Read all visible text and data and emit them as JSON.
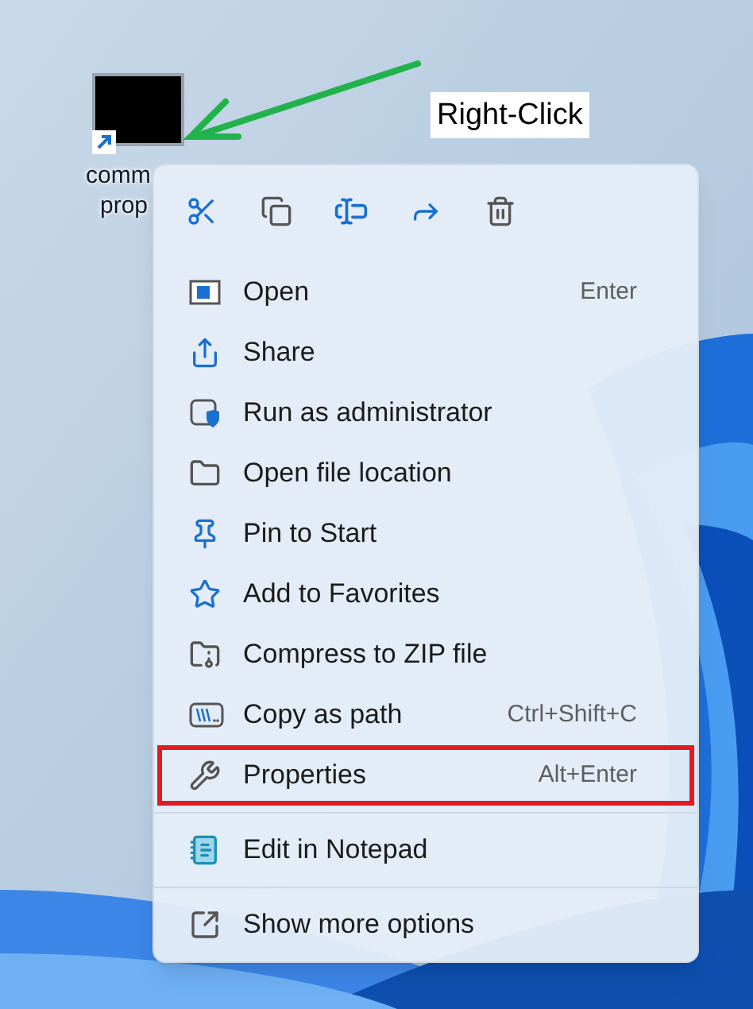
{
  "desktop_icon": {
    "label_lines": [
      "comm",
      "prop"
    ]
  },
  "annotation": {
    "label": "Right-Click"
  },
  "context_menu": {
    "groups": [
      [
        {
          "label": "Open",
          "shortcut": "Enter",
          "highlighted": false
        },
        {
          "label": "Share",
          "highlighted": false
        },
        {
          "label": "Run as administrator",
          "highlighted": false
        },
        {
          "label": "Open file location",
          "highlighted": false
        },
        {
          "label": "Pin to Start",
          "highlighted": false
        },
        {
          "label": "Add to Favorites",
          "highlighted": false
        },
        {
          "label": "Compress to ZIP file",
          "highlighted": false
        },
        {
          "label": "Copy as path",
          "shortcut": "Ctrl+Shift+C",
          "highlighted": false
        },
        {
          "label": "Properties",
          "shortcut": "Alt+Enter",
          "highlighted": true
        }
      ],
      [
        {
          "label": "Edit in Notepad",
          "highlighted": false
        }
      ],
      [
        {
          "label": "Show more options",
          "highlighted": false
        }
      ]
    ]
  }
}
